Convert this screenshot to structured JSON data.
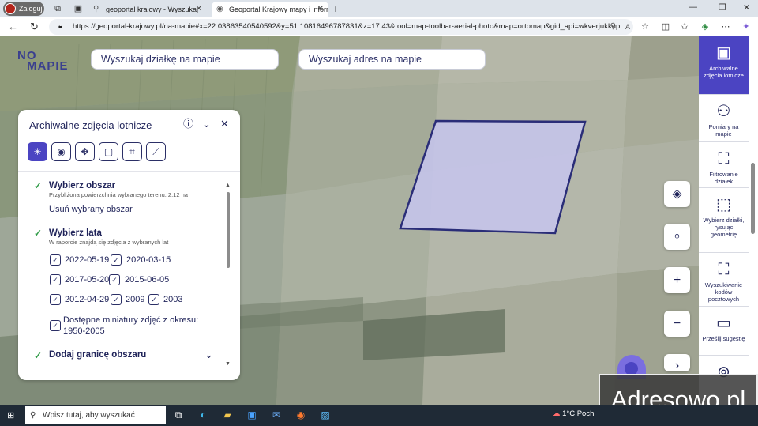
{
  "browser": {
    "profile_label": "Zaloguj",
    "tabs": [
      {
        "title": "geoportal krajowy - Wyszukaj",
        "icon": "search-icon",
        "active": false
      },
      {
        "title": "Geoportal Krajowy mapy i inform",
        "icon": "location-icon",
        "active": true
      }
    ],
    "new_tab": "+",
    "window_controls": [
      "—",
      "❐",
      "✕"
    ],
    "url": "https://geoportal-krajowy.pl/na-mapie#x=22.03863540540592&y=51.10816496787831&z=17.43&tool=map-toolbar-aerial-photo&map=ortomap&gid_api=wkverjukkup..."
  },
  "header": {
    "logo_top": "NO",
    "logo_bottom": "MAPIE",
    "search_parcel": "Wyszukaj działkę na mapie",
    "search_address": "Wyszukaj adres na mapie"
  },
  "panel": {
    "title": "Archiwalne zdjęcia lotnicze",
    "section_area": {
      "title": "Wybierz obszar",
      "subtitle": "Przybliżona powierzchnia wybranego terenu: 2.12 ha",
      "remove_link": "Usuń wybrany obszar"
    },
    "section_years": {
      "title": "Wybierz lata",
      "subtitle": "W raporcie znajdą się zdjęcia z wybranych lat",
      "dates": [
        "2022-05-19",
        "2020-03-15",
        "2017-05-20",
        "2015-06-05",
        "2012-04-29",
        "2009",
        "2003"
      ],
      "thumbnails_label": "Dostępne miniatury zdjęć z okresu: 1950-2005"
    },
    "section_border": {
      "title": "Dodaj granicę obszaru"
    }
  },
  "sidebar": {
    "items": [
      {
        "label": "Archiwalne zdjęcia lotnicze",
        "icon": "photo-icon",
        "active": true
      },
      {
        "label": "Pomiary na mapie",
        "icon": "measure-icon",
        "active": false
      },
      {
        "label": "Filtrowanie działek",
        "icon": "map-search-icon",
        "active": false
      },
      {
        "label": "Wybierz działki, rysując geometrię",
        "icon": "select-area-icon",
        "active": false
      },
      {
        "label": "Wyszukiwanie kodów pocztowych",
        "icon": "postal-search-icon",
        "active": false
      },
      {
        "label": "Prześlij sugestię",
        "icon": "message-icon",
        "active": false
      }
    ]
  },
  "watermark": "Adresowo.pl",
  "taskbar": {
    "search_placeholder": "Wpisz tutaj, aby wyszukać",
    "weather": "1°C  Poch"
  },
  "colors": {
    "accent": "#4b44c2",
    "brand_text": "#1f2359",
    "check": "#2e9b46",
    "selection_fill": "#c7c6ef",
    "selection_stroke": "#2a2d78"
  }
}
